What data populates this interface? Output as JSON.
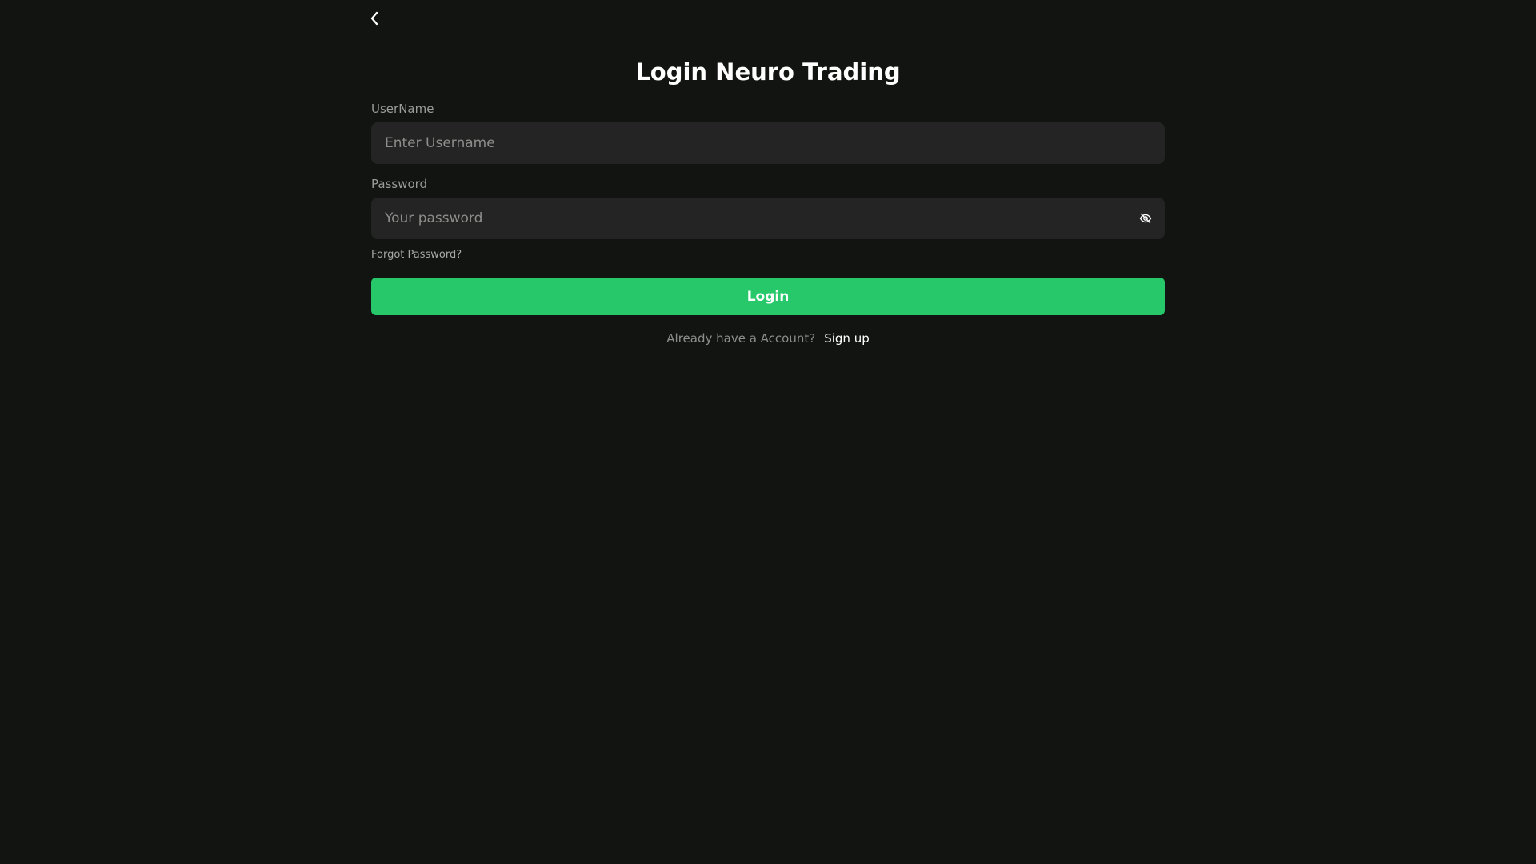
{
  "header": {
    "back_icon": "chevron-left-icon",
    "title": "Login Neuro Trading"
  },
  "form": {
    "username": {
      "label": "UserName",
      "value": "",
      "placeholder": "Enter Username"
    },
    "password": {
      "label": "Password",
      "value": "",
      "placeholder": "Your password",
      "toggle_icon": "eye-off-icon"
    },
    "forgot_password_label": "Forgot Password?",
    "login_label": "Login"
  },
  "footer": {
    "prompt": "Already have a Account?",
    "signup_label": "Sign up"
  },
  "colors": {
    "background": "#111410",
    "input_background": "#232423",
    "accent": "#26c86a",
    "muted_text": "#8c8e8b"
  }
}
